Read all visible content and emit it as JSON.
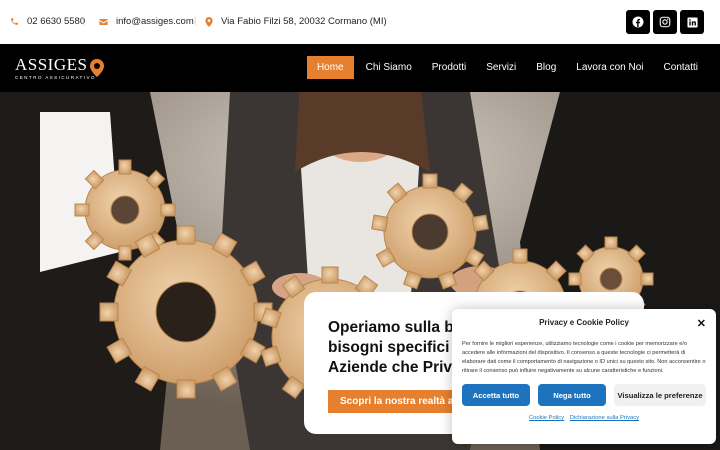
{
  "topbar": {
    "phone": "02 6630 5580",
    "email": "info@assiges.com",
    "address": "Via Fabio Filzi 58, 20032 Cormano (MI)",
    "separator": "|",
    "icons": [
      "phone-icon",
      "mail-icon",
      "location-icon"
    ],
    "socials": [
      "facebook-icon",
      "instagram-icon",
      "linkedin-icon"
    ]
  },
  "brand": {
    "name": "ASSIGES",
    "tagline": "CENTRO ASSICURATIVO"
  },
  "nav": {
    "items": [
      {
        "label": "Home",
        "active": true
      },
      {
        "label": "Chi Siamo"
      },
      {
        "label": "Prodotti"
      },
      {
        "label": "Servizi"
      },
      {
        "label": "Blog"
      },
      {
        "label": "Lavora con Noi"
      },
      {
        "label": "Contatti"
      }
    ]
  },
  "hero": {
    "line1": "Operiamo sulla ba",
    "line2": "bisogni specifici d",
    "line3": "Aziende che Priva",
    "cta": "Scopri la nostra realtà a"
  },
  "cookie": {
    "title": "Privacy e Cookie Policy",
    "close": "✕",
    "text": "Per fornire le migliori esperienze, utilizziamo tecnologie come i cookie per memorizzare e/o accedere alle informazioni del dispositivo. Il consenso a queste tecnologie ci permetterà di elaborare dati come il comportamento di navigazione o ID unici su questo sito. Non acconsentire o ritirare il consenso può influire negativamente su alcune caratteristiche e funzioni.",
    "accept": "Accetta tutto",
    "deny": "Nega tutto",
    "prefs": "Visualizza le preferenze",
    "link1": "Cookie Policy",
    "link2": "Dichiarazione sulla Privacy"
  },
  "colors": {
    "accent": "#e7802e",
    "nav_bg": "#000000",
    "button_blue": "#1e73be"
  }
}
